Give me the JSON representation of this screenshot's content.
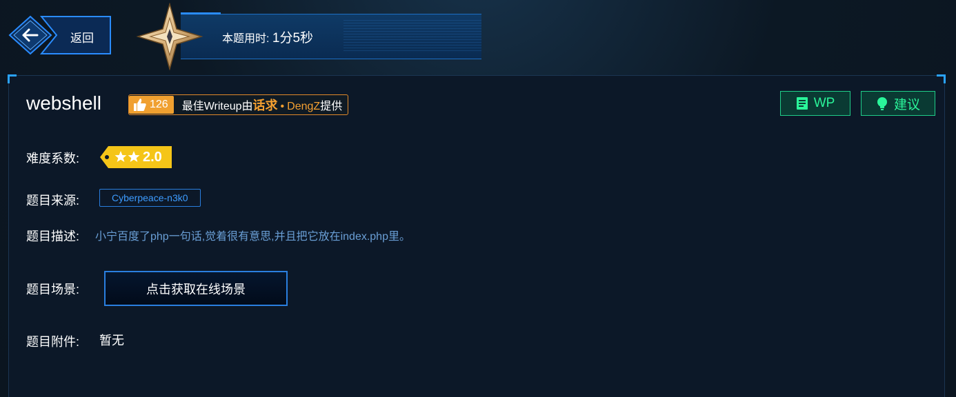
{
  "back": {
    "label": "返回"
  },
  "timer": {
    "label": "本题用时:",
    "value": "1分5秒"
  },
  "challenge": {
    "title": "webshell",
    "likes": "126",
    "writeup_prefix": "最佳Writeup由",
    "writeup_user": "话求",
    "writeup_dot": "•",
    "writeup_author": "DengZ",
    "writeup_suffix": "提供"
  },
  "buttons": {
    "wp": "WP",
    "suggest": "建议"
  },
  "fields": {
    "difficulty_label": "难度系数:",
    "difficulty_value": "2.0",
    "difficulty_stars": 2,
    "source_label": "题目来源:",
    "source_value": "Cyberpeace-n3k0",
    "desc_label": "题目描述:",
    "desc_value": "小宁百度了php一句话,觉着很有意思,并且把它放在index.php里。",
    "scene_label": "题目场景:",
    "scene_button": "点击获取在线场景",
    "attach_label": "题目附件:",
    "attach_value": "暂无"
  },
  "colors": {
    "accent_blue": "#2a7fe0",
    "accent_green": "#2af59a",
    "accent_orange": "#f5a031",
    "difficulty_yellow": "#f5c518"
  },
  "icons": [
    "back-arrow-icon",
    "star-compass-icon",
    "thumbs-up-icon",
    "document-icon",
    "lightbulb-icon",
    "star-icon"
  ]
}
